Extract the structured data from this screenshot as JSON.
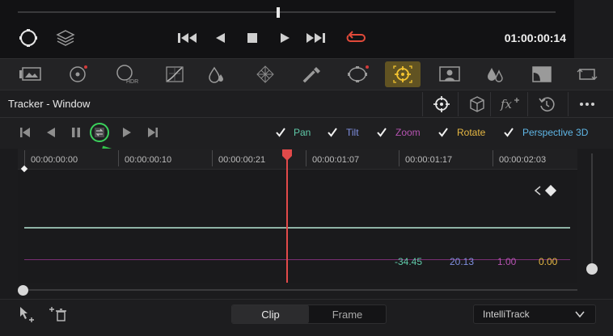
{
  "viewer": {
    "timecode": "01:00:00:14",
    "transport_icons": [
      "jump-to-start-icon",
      "play-reverse-icon",
      "stop-icon",
      "play-icon",
      "jump-to-end-icon",
      "loop-icon"
    ]
  },
  "palette": {
    "icons": [
      "gallery-icon",
      "color-wheels-icon",
      "hdr-icon",
      "curves-icon",
      "qualifier-icon",
      "color-warper-icon",
      "eyedropper-icon",
      "window-icon",
      "tracker-icon",
      "magic-mask-icon",
      "blur-icon",
      "key-icon",
      "sizing-icon"
    ],
    "labels": {
      "hdr": "HDR"
    },
    "active": "tracker-icon"
  },
  "tracker": {
    "title": "Tracker - Window",
    "mode_labels": {
      "fx": "fx"
    },
    "checks": [
      {
        "label": "Pan",
        "color": "#5fc9a8",
        "checked": true
      },
      {
        "label": "Tilt",
        "color": "#7f8fe0",
        "checked": true
      },
      {
        "label": "Zoom",
        "color": "#b653b2",
        "checked": true
      },
      {
        "label": "Rotate",
        "color": "#e7b843",
        "checked": true
      },
      {
        "label": "Perspective 3D",
        "color": "#5fb6e6",
        "checked": true
      }
    ],
    "ruler": [
      "00:00:00:00",
      "00:00:00:10",
      "00:00:00:21",
      "00:00:01:07",
      "00:00:01:17",
      "00:00:02:03"
    ],
    "values": [
      {
        "text": "-34.45",
        "color": "#5fc9a8"
      },
      {
        "text": "20.13",
        "color": "#7f8fe0"
      },
      {
        "text": "1.00",
        "color": "#b653b2"
      },
      {
        "text": "0.00",
        "color": "#e7b843"
      }
    ]
  },
  "bottom": {
    "seg_clip": "Clip",
    "seg_frame": "Frame",
    "intellitrack": "IntelliTrack"
  }
}
